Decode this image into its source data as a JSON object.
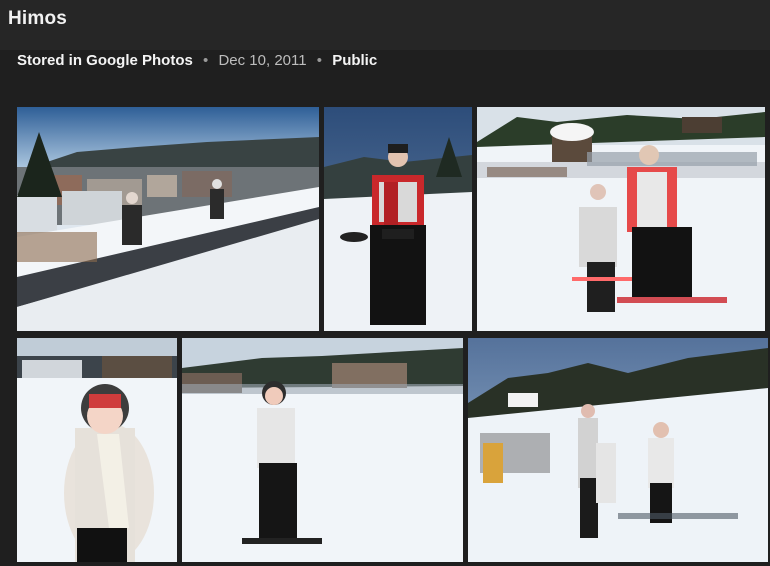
{
  "header": {
    "title": "Himos"
  },
  "info": {
    "storage": "Stored in Google Photos",
    "separator": "•",
    "date": "Dec 10, 2011",
    "visibility": "Public"
  },
  "photos": [
    {
      "name": "photo-1"
    },
    {
      "name": "photo-2"
    },
    {
      "name": "photo-3"
    },
    {
      "name": "photo-4"
    },
    {
      "name": "photo-5"
    },
    {
      "name": "photo-6"
    }
  ]
}
